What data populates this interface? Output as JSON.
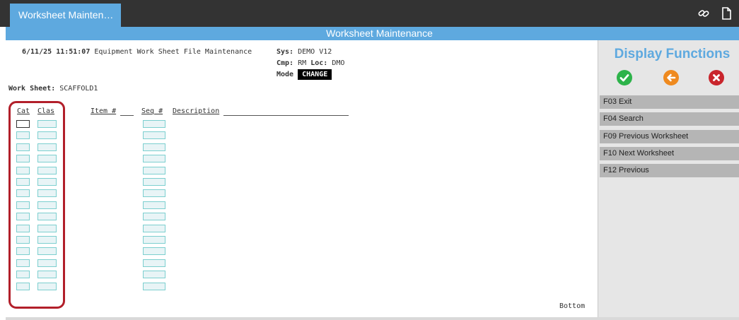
{
  "tab": {
    "label": "Worksheet Mainten…"
  },
  "top_icons": [
    "link-icon",
    "document-icon"
  ],
  "title_bar": "Worksheet Maintenance",
  "header": {
    "date": "6/11/25",
    "time": "11:51:07",
    "program_title": "Equipment Work Sheet File Maintenance",
    "sys_label": "Sys:",
    "sys_value": "DEMO V12",
    "cmp_label": "Cmp:",
    "cmp_value": "RM",
    "loc_label": "Loc:",
    "loc_value": "DMO",
    "mode_label": "Mode",
    "mode_value": "CHANGE"
  },
  "work_sheet": {
    "label": "Work Sheet:",
    "value": "SCAFFOLD1"
  },
  "columns": {
    "cat": "Cat",
    "clas": "Clas",
    "item": "Item #",
    "seq": "Seq #",
    "description": "Description"
  },
  "row_count": 15,
  "footer": {
    "bottom": "Bottom"
  },
  "sidebar": {
    "title": "Display Functions",
    "icons": [
      {
        "name": "accept-icon",
        "color": "#2db34a"
      },
      {
        "name": "back-icon",
        "color": "#ef8a1f"
      },
      {
        "name": "cancel-icon",
        "color": "#c9252c"
      }
    ],
    "function_keys": [
      {
        "label": "F03 Exit"
      },
      {
        "label": "F04 Search"
      },
      {
        "label": "F09 Previous Worksheet"
      },
      {
        "label": "F10 Next Worksheet"
      },
      {
        "label": "F12 Previous"
      }
    ]
  },
  "colors": {
    "accent": "#5ea9df",
    "topbar": "#333333",
    "highlight": "#b21f2a",
    "field_border": "#7ccfcf",
    "sidebar_bg": "#e6e6e6",
    "fkey_bg": "#b5b5b5"
  }
}
